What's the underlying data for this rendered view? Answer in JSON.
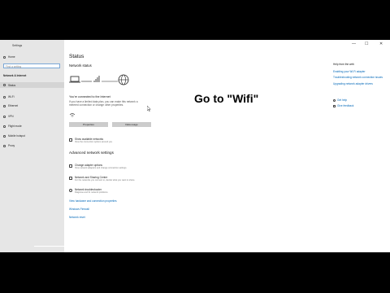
{
  "window": {
    "title": "Settings",
    "controls": {
      "minimize": "—",
      "maximize": "☐",
      "close": "✕"
    }
  },
  "sidebar": {
    "home": "Home",
    "search_placeholder": "Find a setting",
    "section": "Network & Internet",
    "items": [
      {
        "label": "Status",
        "icon": "globe-icon"
      },
      {
        "label": "Wi-Fi",
        "icon": "wifi-icon"
      },
      {
        "label": "Ethernet",
        "icon": "ethernet-icon"
      },
      {
        "label": "VPN",
        "icon": "vpn-icon"
      },
      {
        "label": "Flight mode",
        "icon": "airplane-icon"
      },
      {
        "label": "Mobile hotspot",
        "icon": "hotspot-icon"
      },
      {
        "label": "Proxy",
        "icon": "globe-icon"
      }
    ]
  },
  "main": {
    "title": "Status",
    "network_status": "Network status",
    "connection_title": "You're connected to the Internet",
    "connection_desc_1": "If you have a limited data plan, you can make this network a",
    "connection_desc_2": "metered connection or change other properties.",
    "properties_button": "Properties",
    "data_usage_button": "Data usage",
    "show_networks_title": "Show available networks",
    "show_networks_desc": "View the connection options around you.",
    "advanced_title": "Advanced network settings",
    "adv_items": [
      {
        "title": "Change adapter options",
        "desc": "View network adapters and change connection settings."
      },
      {
        "title": "Network and Sharing Centre",
        "desc": "For the networks you connect to, decide what you want to share."
      },
      {
        "title": "Network troubleshooter",
        "desc": "Diagnose and fix network problems."
      }
    ],
    "link_hardware": "View hardware and connection properties",
    "link_firewall": "Windows Firewall",
    "link_reset": "Network reset"
  },
  "right": {
    "help_title": "Help from the web",
    "links": [
      "Enabling your Wi-Fi adapter",
      "Troubleshooting network connection issues",
      "Upgrading network adapter drivers"
    ],
    "get_help": "Get help",
    "give_feedback": "Give feedback"
  },
  "overlay_text": "Go to \"Wifi\""
}
